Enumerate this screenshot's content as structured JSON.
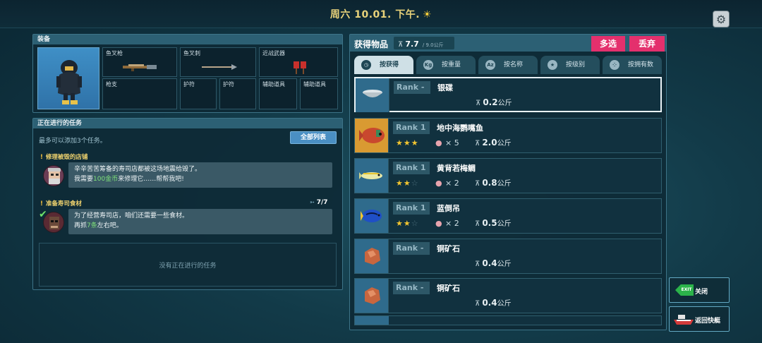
{
  "header": {
    "date_text": "周六 10.01. 下午.",
    "weather_icon": "sun-icon"
  },
  "equipment": {
    "title": "装备",
    "slots": {
      "harpoon": "鱼叉枪",
      "spear": "鱼叉刺",
      "melee": "近战武器",
      "gun": "枪支",
      "charm1": "护符",
      "charm2": "护符",
      "tool1": "辅助道具",
      "tool2": "辅助道具"
    }
  },
  "tasks": {
    "title": "正在进行的任务",
    "limit_text": "最多可以添加3个任务。",
    "list_button": "全部列表",
    "items": [
      {
        "title": "修理被毁的店铺",
        "line1": "辛辛苦苦筹备的寿司店都被这场地震给毁了。",
        "line2_pre": "我需要",
        "line2_hl": "100金币",
        "line2_post": "来修理它……帮帮我吧!"
      },
      {
        "title": "准备寿司食材",
        "progress": "7/7",
        "line1": "为了经营寿司店，咱们还需要一些食材。",
        "line2_pre": "再抓",
        "line2_hl": "7条",
        "line2_post": "左右吧。"
      }
    ],
    "empty_text": "没有正在进行的任务"
  },
  "inventory": {
    "title": "获得物品",
    "weight_current": "7.7",
    "weight_max": "/ 9.0公斤",
    "multi_select": "多选",
    "discard": "丢弃",
    "sort_tabs": [
      "按获得",
      "按重量",
      "按名称",
      "按级别",
      "按拥有数"
    ],
    "rank_label": "Rank",
    "items": [
      {
        "rank": "-",
        "name": "银碟",
        "stars": 0,
        "count": "",
        "weight": "0.2",
        "unit": "公斤",
        "selected": true
      },
      {
        "rank": "1",
        "name": "地中海鹦嘴鱼",
        "stars": 3,
        "count": "× 5",
        "weight": "2.0",
        "unit": "公斤"
      },
      {
        "rank": "1",
        "name": "黄背若梅鲷",
        "stars": 2,
        "count": "× 2",
        "weight": "0.8",
        "unit": "公斤"
      },
      {
        "rank": "1",
        "name": "蓝倒吊",
        "stars": 2,
        "count": "× 2",
        "weight": "0.5",
        "unit": "公斤"
      },
      {
        "rank": "-",
        "name": "铜矿石",
        "stars": 0,
        "count": "",
        "weight": "0.4",
        "unit": "公斤"
      },
      {
        "rank": "-",
        "name": "铜矿石",
        "stars": 0,
        "count": "",
        "weight": "0.4",
        "unit": "公斤"
      }
    ]
  },
  "side_buttons": {
    "close": "关闭",
    "exit_badge": "EXIT",
    "return": "返回快艇"
  }
}
